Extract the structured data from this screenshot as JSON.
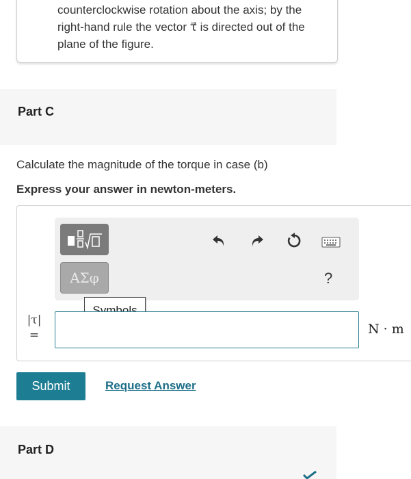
{
  "previous_part": {
    "text": "counterclockwise rotation about the axis; by the right-hand rule the vector τ⃗ is directed out of the plane of the figure."
  },
  "part_c": {
    "label": "Part C",
    "question": "Calculate the magnitude of the torque in case (b)",
    "instruction": "Express your answer in newton-meters.",
    "toolbar": {
      "templates_icon": "fraction-sqrt-templates-icon",
      "symbols_label": "ΑΣφ",
      "tooltip": "Symbols",
      "undo_icon": "undo-icon",
      "redo_icon": "redo-icon",
      "reset_icon": "reset-icon",
      "keyboard_icon": "keyboard-icon",
      "help_label": "?"
    },
    "answer": {
      "variable_label": "|τ|",
      "equals": "=",
      "value": "",
      "unit": "N · m"
    },
    "submit_label": "Submit",
    "request_answer_label": "Request Answer"
  },
  "part_d": {
    "label": "Part D"
  },
  "colors": {
    "accent": "#1d7d93",
    "link": "#1d6f88",
    "input_border": "#2a7c8f",
    "part_band": "#f6f6f6"
  }
}
